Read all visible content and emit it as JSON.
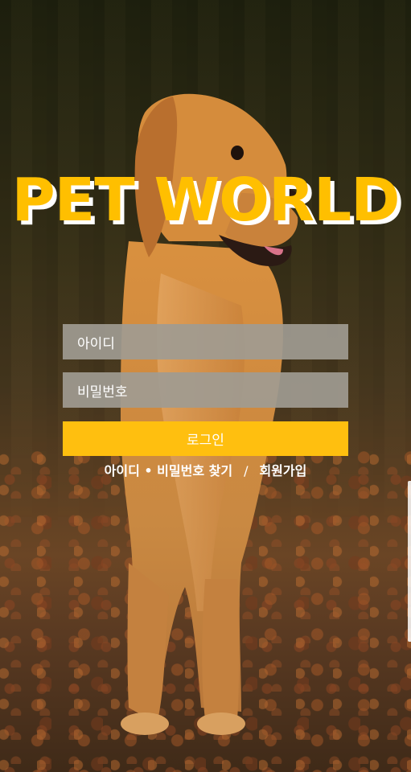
{
  "app": {
    "title": "PET WORLD"
  },
  "login_form": {
    "id_placeholder": "아이디",
    "password_placeholder": "비밀번호",
    "login_label": "로그인"
  },
  "links": {
    "find_account": "아이디 • 비밀번호 찾기",
    "separator": "/",
    "signup": "회원가입"
  },
  "colors": {
    "accent": "#ffbf00",
    "field_bg": "#a09b91",
    "text_light": "#ffffff"
  },
  "background": {
    "subject": "golden-retriever-dog-photo"
  }
}
